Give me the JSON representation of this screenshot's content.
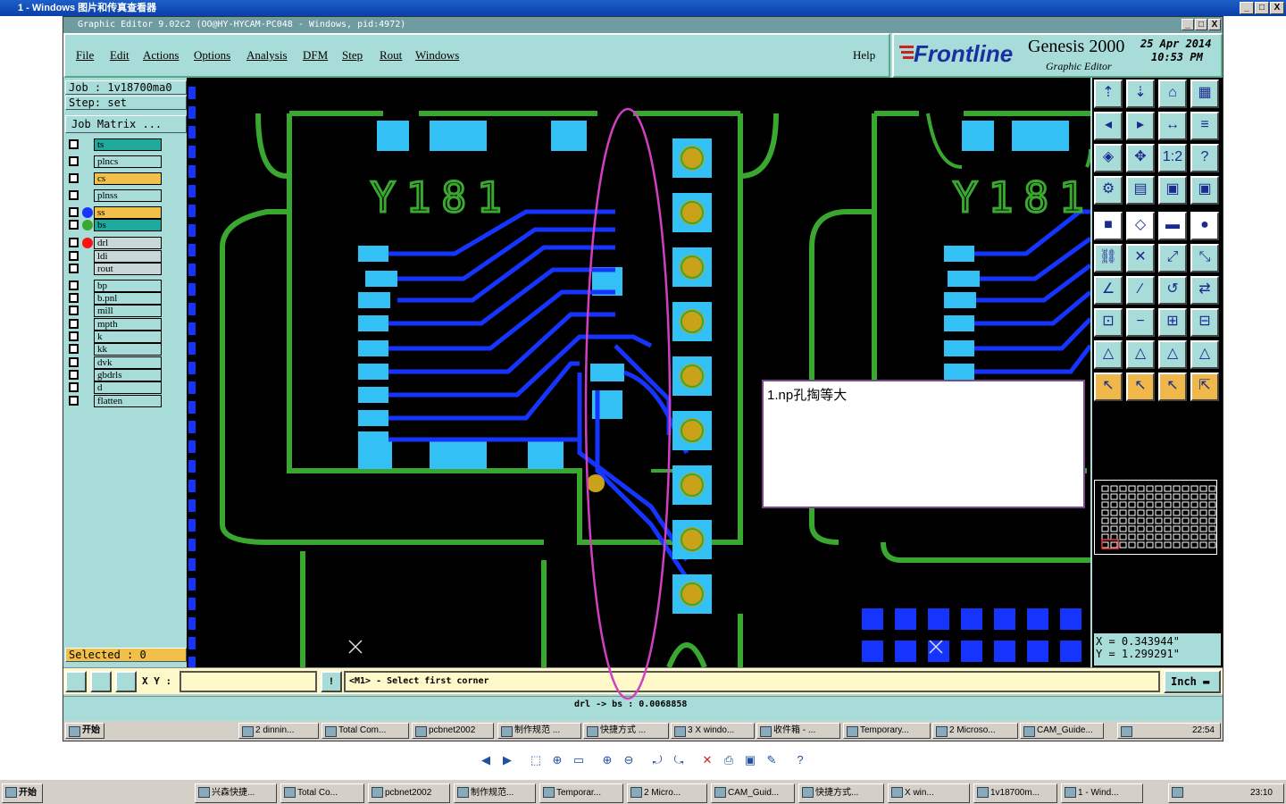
{
  "viewer": {
    "title": "1 - Windows 图片和传真查看器",
    "min": "_",
    "max": "□",
    "close": "X"
  },
  "app": {
    "title": "Graphic Editor 9.02c2 (OO@HY-HYCAM-PC048 - Windows, pid:4972)",
    "menus": [
      "File",
      "Edit",
      "Actions",
      "Options",
      "Analysis",
      "DFM",
      "Step",
      "Rout",
      "Windows"
    ],
    "help": "Help",
    "logo_brand": "Frontline",
    "logo_product": "Genesis 2000",
    "logo_sub": "Graphic Editor",
    "date": "25 Apr 2014",
    "time": "10:53 PM"
  },
  "sidebar": {
    "job": "Job : 1v18700ma0",
    "step": "Step: set",
    "job_matrix": "Job Matrix ...",
    "selected": "Selected : 0",
    "layers": [
      {
        "name": "ts",
        "color": "#1fa89c",
        "dot": ""
      },
      {
        "name": "plncs",
        "color": "#a8dcd8",
        "dot": ""
      },
      {
        "name": "cs",
        "color": "#f0c04a",
        "dot": ""
      },
      {
        "name": "plnss",
        "color": "#a8dcd8",
        "dot": ""
      },
      {
        "name": "ss",
        "color": "#f0c04a",
        "dot": "#1535ff"
      },
      {
        "name": "bs",
        "color": "#1fa89c",
        "dot": "#3aa830"
      },
      {
        "name": "drl",
        "color": "#c8d8d8",
        "dot": "#ff1010"
      },
      {
        "name": "ldi",
        "color": "#c8d8d8",
        "dot": ""
      },
      {
        "name": "rout",
        "color": "#c8d8d8",
        "dot": ""
      },
      {
        "name": "bp",
        "color": "#a8dcd8",
        "dot": ""
      },
      {
        "name": "b.pnl",
        "color": "#a8dcd8",
        "dot": ""
      },
      {
        "name": "mill",
        "color": "#a8dcd8",
        "dot": ""
      },
      {
        "name": "mpth",
        "color": "#a8dcd8",
        "dot": ""
      },
      {
        "name": "k",
        "color": "#a8dcd8",
        "dot": ""
      },
      {
        "name": "kk",
        "color": "#a8dcd8",
        "dot": ""
      },
      {
        "name": "dvk",
        "color": "#a8dcd8",
        "dot": ""
      },
      {
        "name": "gbdrls",
        "color": "#a8dcd8",
        "dot": ""
      },
      {
        "name": "d",
        "color": "#a8dcd8",
        "dot": ""
      },
      {
        "name": "flatten",
        "color": "#a8dcd8",
        "dot": ""
      }
    ]
  },
  "canvas": {
    "silk_left": "Y181",
    "silk_right": "Y181",
    "annotation": "1.np孔掏等大"
  },
  "readout": {
    "x": "X = 0.343944\"",
    "y": "Y = 1.299291\"",
    "units": "Inch"
  },
  "bottom": {
    "xy_label": "X Y :",
    "prompt": "<M1> - Select first corner",
    "measure": "drl -> bs : 0.0068858"
  },
  "inner_taskbar": {
    "start": "开始",
    "items": [
      "2 dinnin...",
      "Total Com...",
      "pcbnet2002",
      "制作规范 ...",
      "快捷方式 ...",
      "3 X windo...",
      "收件箱 - ...",
      "Temporary...",
      "2 Microso...",
      "CAM_Guide..."
    ],
    "clock": "22:54"
  },
  "taskbar": {
    "start": "开始",
    "items": [
      "兴森快捷...",
      "Total Co...",
      "pcbnet2002",
      "制作规范...",
      "Temporar...",
      "2 Micro...",
      "CAM_Guid...",
      "快捷方式...",
      "X win...",
      "1v18700m...",
      "1 - Wind..."
    ],
    "lang": "CH",
    "clock": "23:10"
  },
  "colors": {
    "app_bg": "#a8dcd8",
    "trace": "#1535ff",
    "pad": "#33c0f5",
    "outline": "#3aa830",
    "drill": "#c9a21a",
    "annotation_ellipse": "#d040c0"
  }
}
